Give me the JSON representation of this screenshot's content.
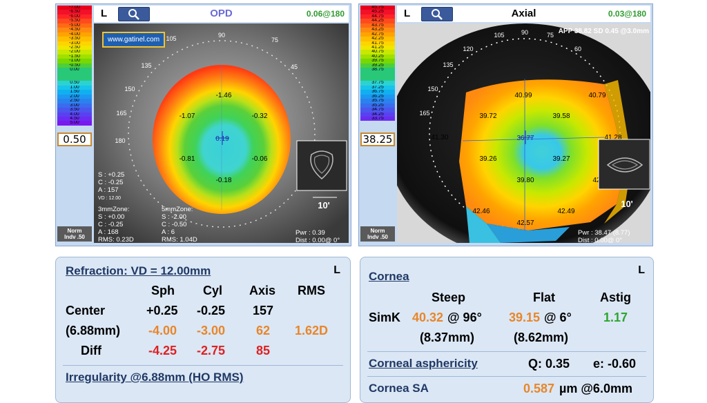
{
  "opd": {
    "eye": "L",
    "title": "OPD",
    "corner": "0.06@180",
    "url": "www.gatinel.com",
    "scale_labels": [
      "-7.00",
      "-6.50",
      "-6.00",
      "-5.50",
      "-5.00",
      "-4.50",
      "-4.00",
      "-3.50",
      "-3.00",
      "-2.50",
      "-2.00",
      "-1.50",
      "-1.00",
      "-0.50",
      "0.00",
      "",
      "",
      "0.50",
      "1.00",
      "1.50",
      "2.00",
      "2.50",
      "3.00",
      "3.50",
      "4.00",
      "4.50",
      "5.00"
    ],
    "scale_colors": [
      "#e8001a",
      "#f2102a",
      "#ff2626",
      "#ff4a1e",
      "#ff6a14",
      "#ff8a10",
      "#ffa400",
      "#ffbe00",
      "#ffd400",
      "#f0e600",
      "#c8e800",
      "#a0e000",
      "#78d800",
      "#4ecf3a",
      "#28c878",
      "#28c878",
      "#28c878",
      "#2cd2d2",
      "#18c4ea",
      "#10b0f0",
      "#1c98f0",
      "#2a82ee",
      "#3a6cee",
      "#4a56ee",
      "#5a40f0",
      "#6a2cf0",
      "#7a18f0"
    ],
    "scale_value": "0.50",
    "norm_label": "Norm",
    "indv_label": "Indv .50",
    "center_value": "0.19",
    "points": [
      "-1.46",
      "-1.07",
      "-0.32",
      "-0.81",
      "-0.06",
      "-0.18"
    ],
    "angles": [
      "105",
      "90",
      "75",
      "45",
      "135",
      "150",
      "165",
      "180"
    ],
    "left_stats": [
      "S : +0.25",
      "C : -0.25",
      "A : 157",
      "VD : 12.00"
    ],
    "zone3_title": "3mmZone:",
    "zone3": [
      "S : +0.00",
      "C : -0.25",
      "A : 168"
    ],
    "zone3_rms": "RMS: 0.23D",
    "zone5_title": "5mmZone:",
    "zone5": [
      "S : -2.00",
      "C : -0.50",
      "A : 6"
    ],
    "zone5_rms": "RMS: 1.04D",
    "scale_bar": "10'",
    "pwr": "Pwr :  0.39",
    "dist": "Dist : 0.00@ 0°"
  },
  "axial": {
    "eye": "L",
    "title": "Axial",
    "corner": "0.03@180",
    "app": "APP 38.82 SD 0.45 @3.0mm",
    "scale_labels": [
      "45.75",
      "45.25",
      "44.75",
      "44.25",
      "43.75",
      "43.25",
      "42.75",
      "42.25",
      "41.75",
      "41.25",
      "40.75",
      "40.25",
      "39.75",
      "39.25",
      "38.75",
      "",
      "",
      "37.75",
      "37.25",
      "36.75",
      "36.25",
      "35.75",
      "35.25",
      "34.75",
      "34.25",
      "33.75"
    ],
    "scale_colors": [
      "#e8001a",
      "#f2102a",
      "#ff2626",
      "#ff4a1e",
      "#ff6a14",
      "#ff8a10",
      "#ffa400",
      "#ffbe00",
      "#ffd400",
      "#f0e600",
      "#c8e800",
      "#a0e000",
      "#78d800",
      "#4ecf3a",
      "#28c878",
      "#28c878",
      "#28c878",
      "#2cd2d2",
      "#18c4ea",
      "#10b0f0",
      "#1c98f0",
      "#2a82ee",
      "#3a6cee",
      "#4a56ee",
      "#5a40f0",
      "#6a2cf0"
    ],
    "scale_value": "38.25",
    "norm_label": "Norm",
    "indv_label": "Indv .50",
    "center_value": "36.77",
    "points": [
      "40.99",
      "40.79",
      "39.72",
      "39.58",
      "41.30",
      "41.28",
      "39.26",
      "39.27",
      "39.80",
      "42.46",
      "42.49",
      "42.57",
      "42"
    ],
    "angles": [
      "120",
      "105",
      "90",
      "75",
      "60",
      "135",
      "150",
      "165"
    ],
    "scale_bar": "10'",
    "pwr": "Pwr : 38.47 (8.77)",
    "dist": "Dist : 0.00@ 0°"
  },
  "refraction": {
    "title": "Refraction: VD = 12.00mm",
    "eye": "L",
    "headers": [
      "Sph",
      "Cyl",
      "Axis",
      "RMS"
    ],
    "row_center": {
      "label": "Center",
      "sph": "+0.25",
      "cyl": "-0.25",
      "axis": "157"
    },
    "row_zone": {
      "label": "(6.88mm)",
      "sph": "-4.00",
      "cyl": "-3.00",
      "axis": "62",
      "rms": "1.62D"
    },
    "row_diff": {
      "label": "Diff",
      "sph": "-4.25",
      "cyl": "-2.75",
      "axis": "85"
    },
    "irregularity": "Irregularity @6.88mm (HO RMS)"
  },
  "cornea": {
    "eye": "L",
    "title": "Cornea",
    "headers": [
      "Steep",
      "Flat",
      "Astig"
    ],
    "simk_label": "SimK",
    "steep": "40.32",
    "steep_axis": "@ 96°",
    "flat": "39.15",
    "flat_axis": "@  6°",
    "astig": "1.17",
    "steep_radius": "(8.37mm)",
    "flat_radius": "(8.62mm)",
    "asphericity_title": "Corneal asphericity",
    "q": "Q: 0.35",
    "e": "e: -0.60",
    "sa_title": "Cornea SA",
    "sa_value": "0.587",
    "sa_unit": "µm @6.0mm"
  }
}
